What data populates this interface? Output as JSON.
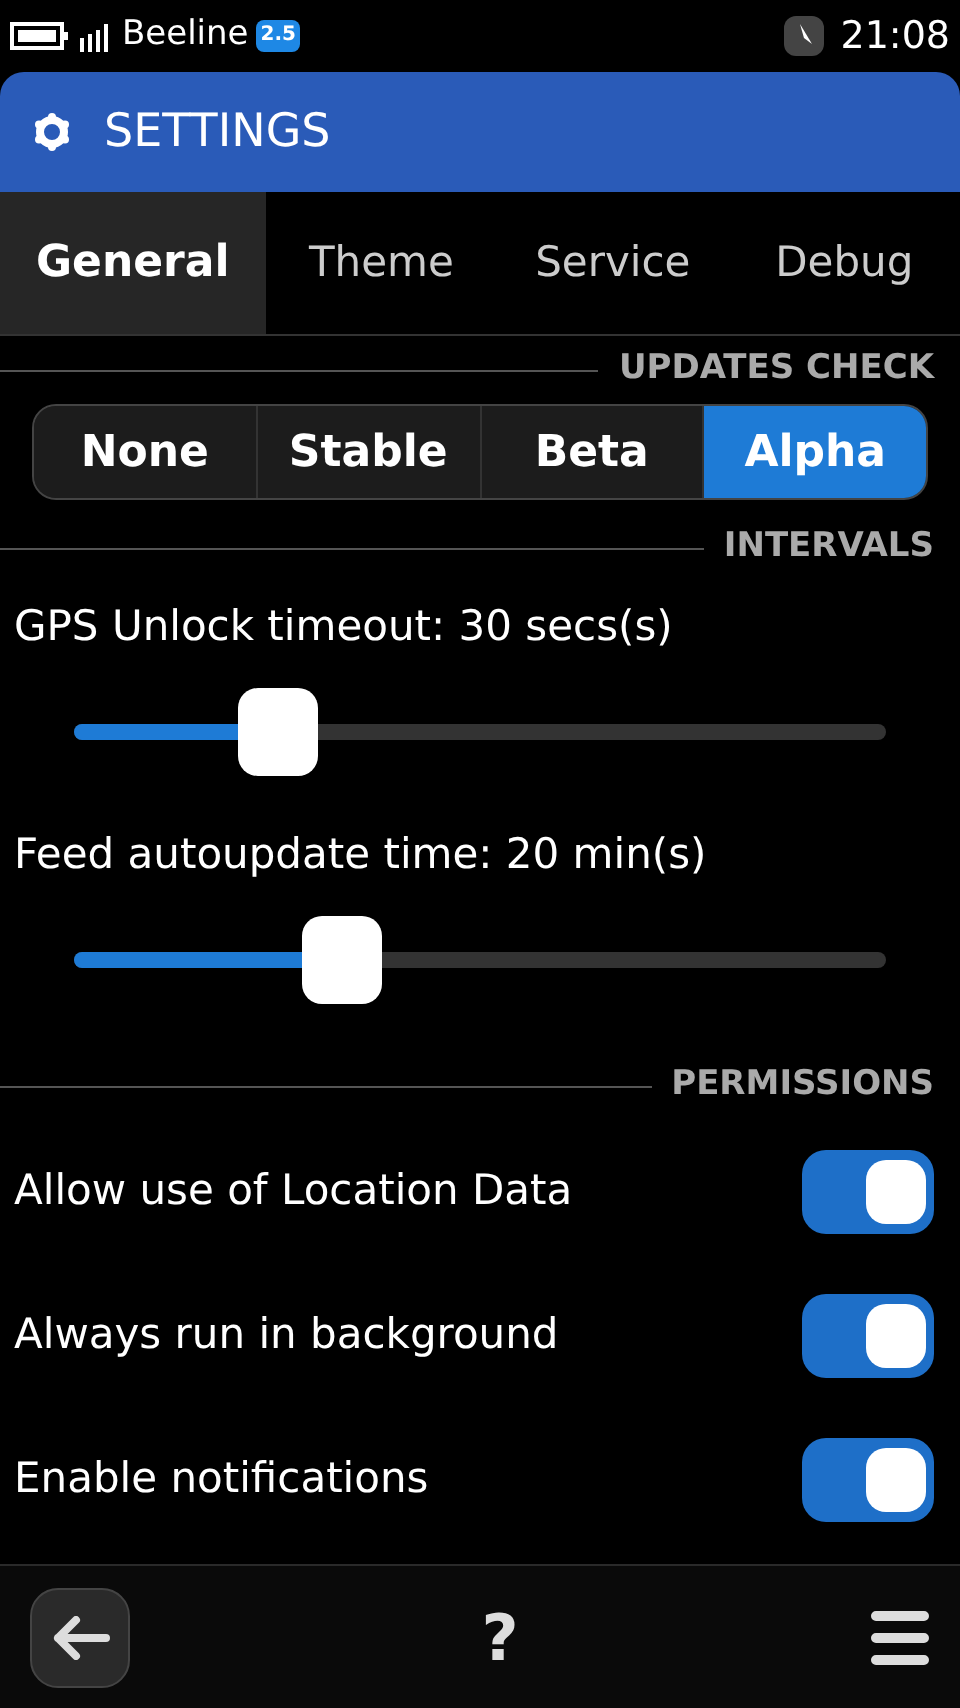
{
  "status_bar": {
    "carrier": "Beeline",
    "network_badge": "2.5",
    "time": "21:08"
  },
  "header": {
    "title": "SETTINGS"
  },
  "tabs": [
    {
      "label": "General",
      "selected": true
    },
    {
      "label": "Theme",
      "selected": false
    },
    {
      "label": "Service",
      "selected": false
    },
    {
      "label": "Debug",
      "selected": false
    }
  ],
  "updates_check": {
    "heading": "UPDATES CHECK",
    "options": [
      {
        "label": "None",
        "selected": false
      },
      {
        "label": "Stable",
        "selected": false
      },
      {
        "label": "Beta",
        "selected": false
      },
      {
        "label": "Alpha",
        "selected": true
      }
    ]
  },
  "intervals": {
    "heading": "INTERVALS",
    "sliders": [
      {
        "label": "GPS Unlock timeout: 30 secs(s)",
        "level": 0.25
      },
      {
        "label": "Feed autoupdate time: 20 min(s)",
        "level": 0.33
      }
    ]
  },
  "permissions": {
    "heading": "PERMISSIONS",
    "switches": [
      {
        "label": "Allow use of Location Data",
        "on": true
      },
      {
        "label": "Always run in background",
        "on": true
      },
      {
        "label": "Enable notifications",
        "on": true
      }
    ]
  },
  "toolbar": {
    "help": "?"
  }
}
